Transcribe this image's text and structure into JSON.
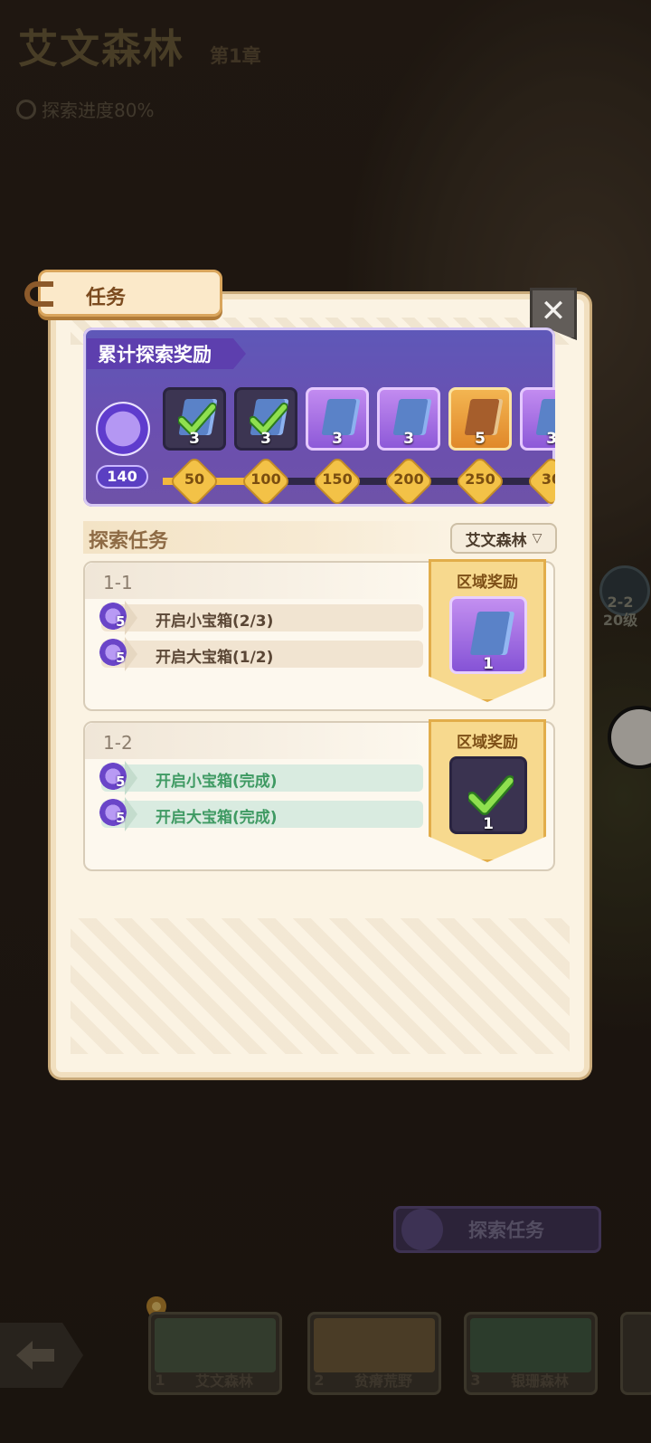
{
  "map": {
    "region_title": "艾文森林",
    "chapter": "第1章",
    "progress_text": "探索进度80%",
    "node_label_line1": "2-2",
    "node_label_line2": "20级"
  },
  "dialog": {
    "tab_title": "任务",
    "close_icon": "close-icon",
    "banner": {
      "title": "累计探索奖励",
      "current_points": "140",
      "progress_fraction": 0.29,
      "items": [
        {
          "qty": "3",
          "state": "claimed",
          "icon": "book-icon"
        },
        {
          "qty": "3",
          "state": "claimed",
          "icon": "book-icon"
        },
        {
          "qty": "3",
          "state": "epic",
          "icon": "book-icon"
        },
        {
          "qty": "3",
          "state": "epic",
          "icon": "book-icon"
        },
        {
          "qty": "5",
          "state": "gold",
          "icon": "book-icon"
        },
        {
          "qty": "3",
          "state": "epic",
          "icon": "book-icon"
        }
      ],
      "milestones": [
        "50",
        "100",
        "150",
        "200",
        "250",
        "30"
      ]
    },
    "section_title": "探索任务",
    "filter_value": "艾文森林",
    "tasks": [
      {
        "id": "1-1",
        "reward_title": "区域奖励",
        "reward_qty": "1",
        "reward_state": "epic",
        "rows": [
          {
            "points": "5",
            "text": "开启小宝箱(2/3)",
            "done": false
          },
          {
            "points": "5",
            "text": "开启大宝箱(1/2)",
            "done": false
          }
        ]
      },
      {
        "id": "1-2",
        "reward_title": "区域奖励",
        "reward_qty": "1",
        "reward_state": "claimed",
        "rows": [
          {
            "points": "5",
            "text": "开启小宝箱(完成)",
            "done": true
          },
          {
            "points": "5",
            "text": "开启大宝箱(完成)",
            "done": true
          }
        ]
      }
    ]
  },
  "bottom": {
    "explore_button": "探索任务",
    "locations": [
      {
        "num": "1",
        "name": "艾文森林"
      },
      {
        "num": "2",
        "name": "贫瘠荒野"
      },
      {
        "num": "3",
        "name": "银珊森林"
      }
    ]
  },
  "colors": {
    "panel_bg": "#fbf3e3",
    "banner_purple": "#6b4fb0",
    "progress_gold": "#f2b83d",
    "done_green": "#3f9a63"
  }
}
